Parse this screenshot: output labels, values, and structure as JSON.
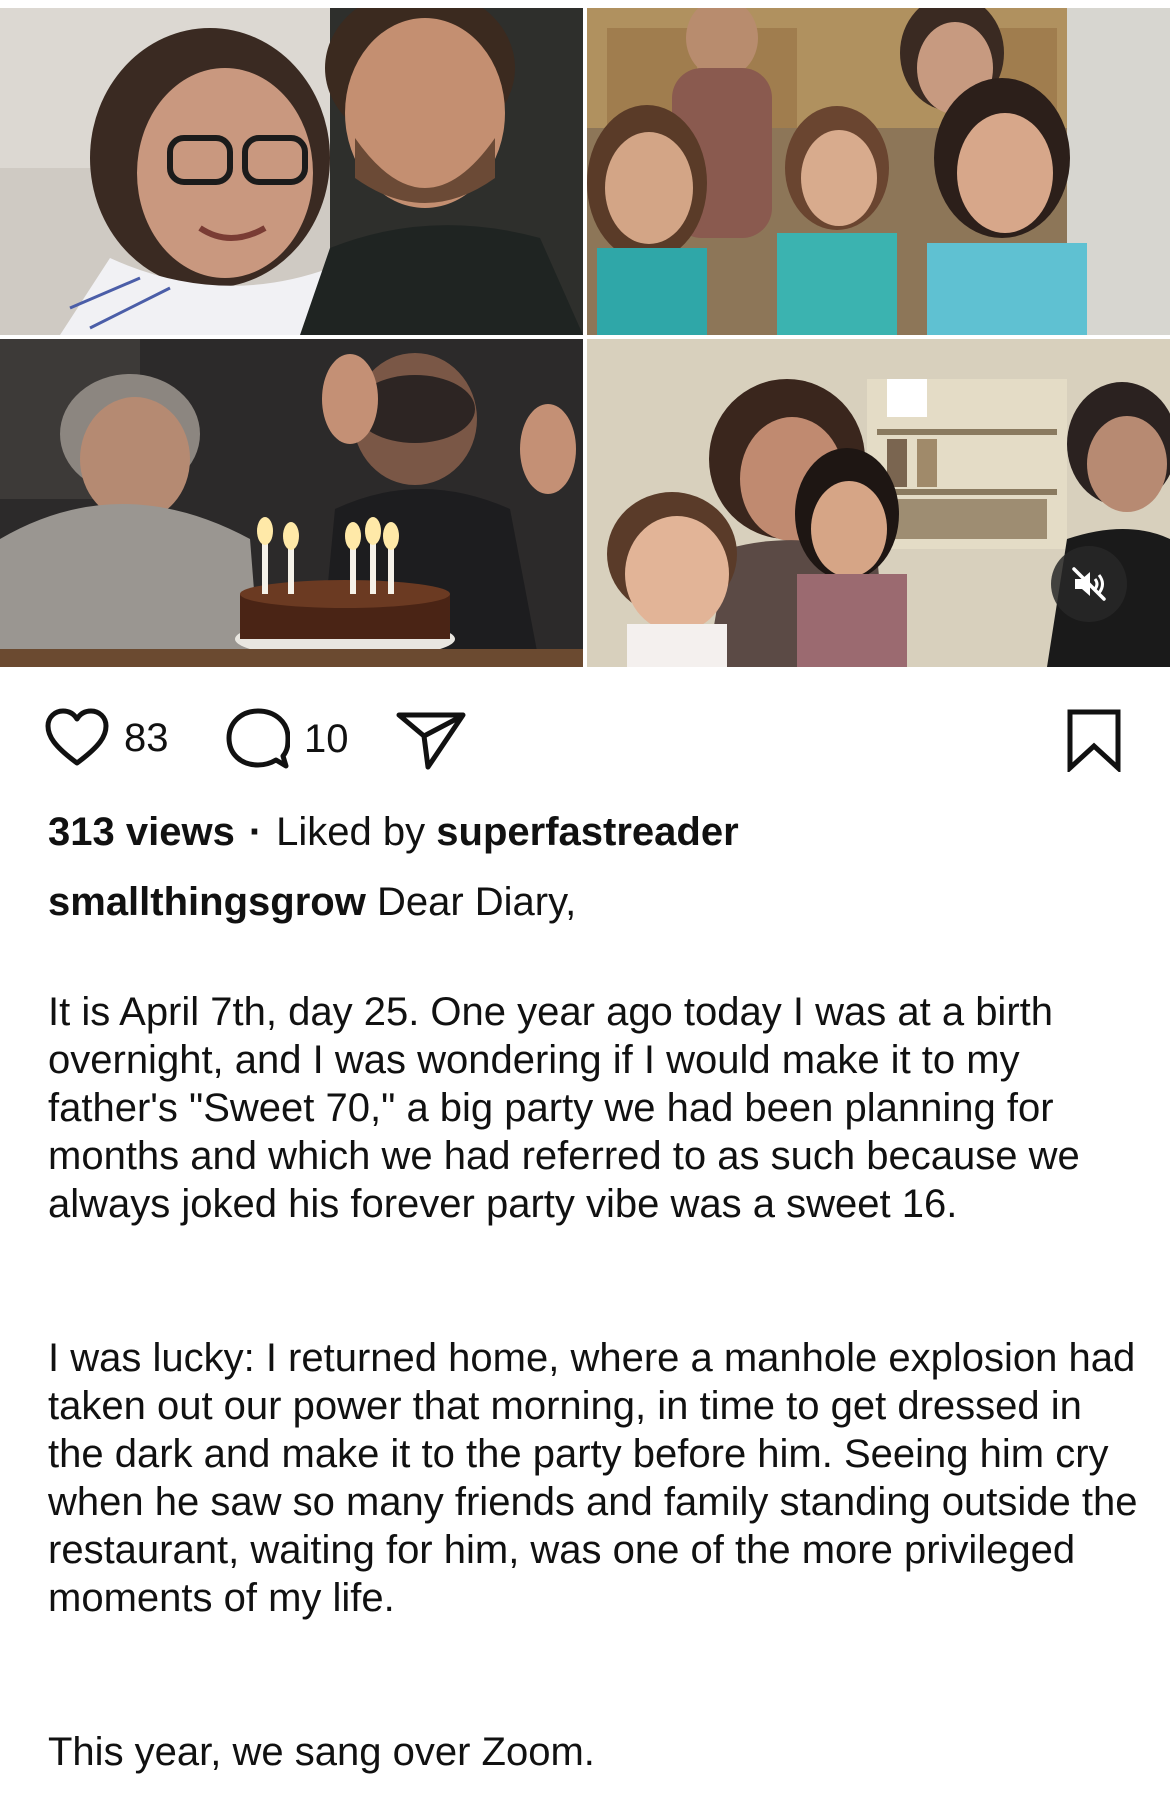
{
  "post": {
    "media": {
      "tiles": [
        {
          "name": "couple-video-tile"
        },
        {
          "name": "family-kitchen-video-tile"
        },
        {
          "name": "grandparents-cake-video-tile"
        },
        {
          "name": "family-livingroom-video-tile"
        }
      ],
      "mute_icon": "speaker-muted-icon"
    },
    "actions": {
      "like_icon": "heart-icon",
      "like_count": "83",
      "comment_icon": "comment-icon",
      "comment_count": "10",
      "share_icon": "send-icon",
      "save_icon": "bookmark-icon"
    },
    "stats": {
      "views": "313 views",
      "separator": "·",
      "liked_by_prefix": "Liked by",
      "liked_by_user": "superfastreader"
    },
    "caption": {
      "username": "smallthingsgrow",
      "first_line": "Dear Diary,",
      "paragraphs": [
        "It is April 7th, day 25. One year ago today I was at a birth overnight, and I was wondering if I would make it to my father's \"Sweet 70,\" a big party we had been planning for months and which we had referred to as such because we always joked his forever party vibe was a sweet 16.",
        "I was lucky: I returned home, where a manhole explosion had taken out our power that morning, in time to get dressed in the dark and make it to the party before him. Seeing him cry when he saw so many friends and family standing outside the restaurant, waiting for him, was one of the more privileged moments of my life.",
        "This year, we sang over Zoom."
      ]
    },
    "colors": {
      "text": "#111111",
      "background": "#ffffff",
      "mute_bg": "#282828"
    }
  }
}
